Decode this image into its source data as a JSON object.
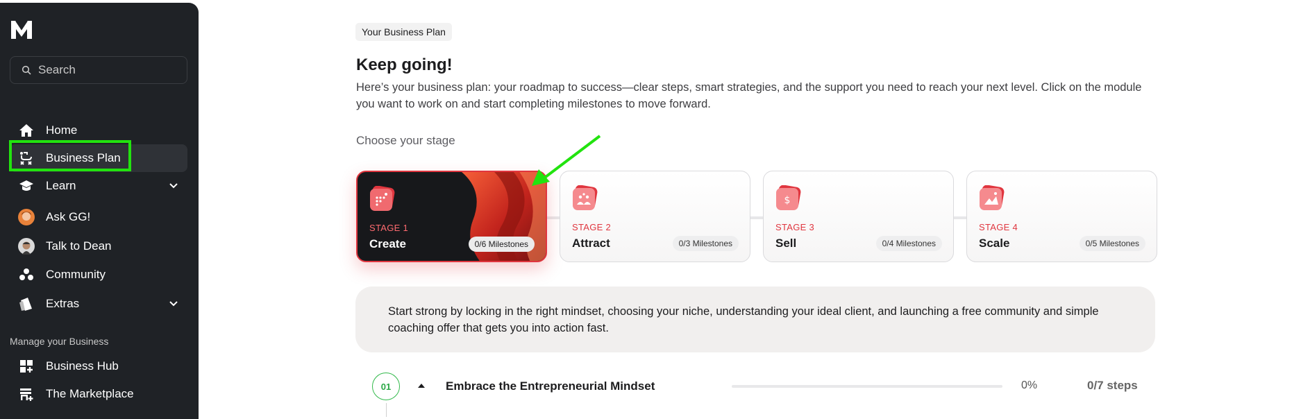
{
  "sidebar": {
    "search_placeholder": "Search",
    "nav": [
      {
        "label": "Home",
        "icon": "home-icon"
      },
      {
        "label": "Business Plan",
        "icon": "route-icon"
      },
      {
        "label": "Learn",
        "icon": "graduation-cap-icon"
      },
      {
        "label": "Ask GG!",
        "icon": "avatar"
      },
      {
        "label": "Talk to Dean",
        "icon": "avatar"
      },
      {
        "label": "Community",
        "icon": "community-icon"
      },
      {
        "label": "Extras",
        "icon": "extras-icon"
      }
    ],
    "manage_section_label": "Manage your Business",
    "manage_nav": [
      {
        "label": "Business Hub",
        "icon": "grid-plus-icon"
      },
      {
        "label": "The Marketplace",
        "icon": "store-icon"
      }
    ]
  },
  "main": {
    "tag": "Your Business Plan",
    "title": "Keep going!",
    "description_line1": "Here’s your business plan: your roadmap to success—clear steps, smart strategies, and the support you need to reach your next level. Click on the module",
    "description_line2": "you want to work on and start completing milestones to move forward.",
    "choose_stage_label": "Choose your stage",
    "stages": [
      {
        "number": "STAGE 1",
        "name": "Create",
        "milestones": "0/6 Milestones"
      },
      {
        "number": "STAGE 2",
        "name": "Attract",
        "milestones": "0/3 Milestones"
      },
      {
        "number": "STAGE 3",
        "name": "Sell",
        "milestones": "0/4 Milestones"
      },
      {
        "number": "STAGE 4",
        "name": "Scale",
        "milestones": "0/5 Milestones"
      }
    ],
    "stage_description": "Start strong by locking in the right mindset, choosing your niche, understanding your ideal client, and launching a free community and simple coaching offer that gets you into action fast.",
    "module": {
      "number": "01",
      "title": "Embrace the Entrepreneurial Mindset",
      "progress_percent": "0%",
      "progress_value": 0,
      "steps": "0/7 steps"
    }
  },
  "colors": {
    "sidebar_bg": "#1f2226",
    "accent_red": "#e0363f",
    "highlight_green": "#22e30f",
    "progress_green": "#31b94a"
  }
}
